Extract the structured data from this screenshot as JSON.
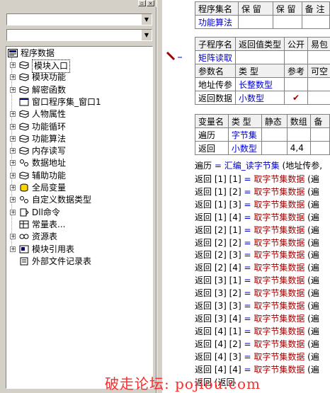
{
  "left_panel": {
    "combo1_value": "",
    "combo2_value": "",
    "tree": {
      "root": "程序数据",
      "items": [
        {
          "label": "模块入口",
          "selected": true
        },
        {
          "label": "模块功能"
        },
        {
          "label": "解密函数"
        },
        {
          "label": "窗口程序集_窗口1"
        },
        {
          "label": "人物属性"
        },
        {
          "label": "功能循环"
        },
        {
          "label": "功能算法"
        },
        {
          "label": "内存读写"
        },
        {
          "label": "数据地址"
        },
        {
          "label": "辅助功能"
        },
        {
          "label": "全局变量"
        },
        {
          "label": "自定义数据类型"
        },
        {
          "label": "Dll命令"
        },
        {
          "label": "常量表..."
        },
        {
          "label": "资源表"
        },
        {
          "label": "模块引用表"
        },
        {
          "label": "外部文件记录表"
        }
      ]
    }
  },
  "assembly_table": {
    "headers": [
      "程序集名",
      "保 留",
      "保 留",
      "备 注"
    ],
    "name": "功能算法"
  },
  "sub_table": {
    "headers": [
      "子程序名",
      "返回值类型",
      "公开",
      "易包"
    ],
    "name": "矩阵读取",
    "param_headers": [
      "参数名",
      "类 型",
      "参考",
      "可空"
    ],
    "params": [
      {
        "name": "地址传参",
        "type": "长整数型",
        "ref": ""
      },
      {
        "name": "返回数据",
        "type": "小数型",
        "ref": "✔"
      }
    ]
  },
  "var_table": {
    "headers": [
      "变量名",
      "类 型",
      "静态",
      "数组",
      "备"
    ],
    "vars": [
      {
        "name": "遍历",
        "type": "字节集",
        "array": ""
      },
      {
        "name": "返回",
        "type": "小数型",
        "array": "4,4"
      }
    ]
  },
  "code": {
    "first_line": {
      "lhs": "遍历",
      "op": " = ",
      "fn": "汇编_读字节集",
      "rest": " (地址传参,"
    },
    "lines": [
      {
        "idx1": "1",
        "idx2": "1"
      },
      {
        "idx1": "1",
        "idx2": "2"
      },
      {
        "idx1": "1",
        "idx2": "3"
      },
      {
        "idx1": "1",
        "idx2": "4"
      },
      {
        "idx1": "2",
        "idx2": "1"
      },
      {
        "idx1": "2",
        "idx2": "2"
      },
      {
        "idx1": "2",
        "idx2": "3"
      },
      {
        "idx1": "2",
        "idx2": "4"
      },
      {
        "idx1": "3",
        "idx2": "1"
      },
      {
        "idx1": "3",
        "idx2": "2"
      },
      {
        "idx1": "3",
        "idx2": "3"
      },
      {
        "idx1": "3",
        "idx2": "4"
      },
      {
        "idx1": "4",
        "idx2": "1"
      },
      {
        "idx1": "4",
        "idx2": "2"
      },
      {
        "idx1": "4",
        "idx2": "3"
      },
      {
        "idx1": "4",
        "idx2": "4"
      }
    ],
    "line_var": "返回",
    "line_fn": "取字节集数据",
    "line_tail": " (遍",
    "last_line": "返回 (返回"
  },
  "watermark": "破走论坛: pojiou.com"
}
